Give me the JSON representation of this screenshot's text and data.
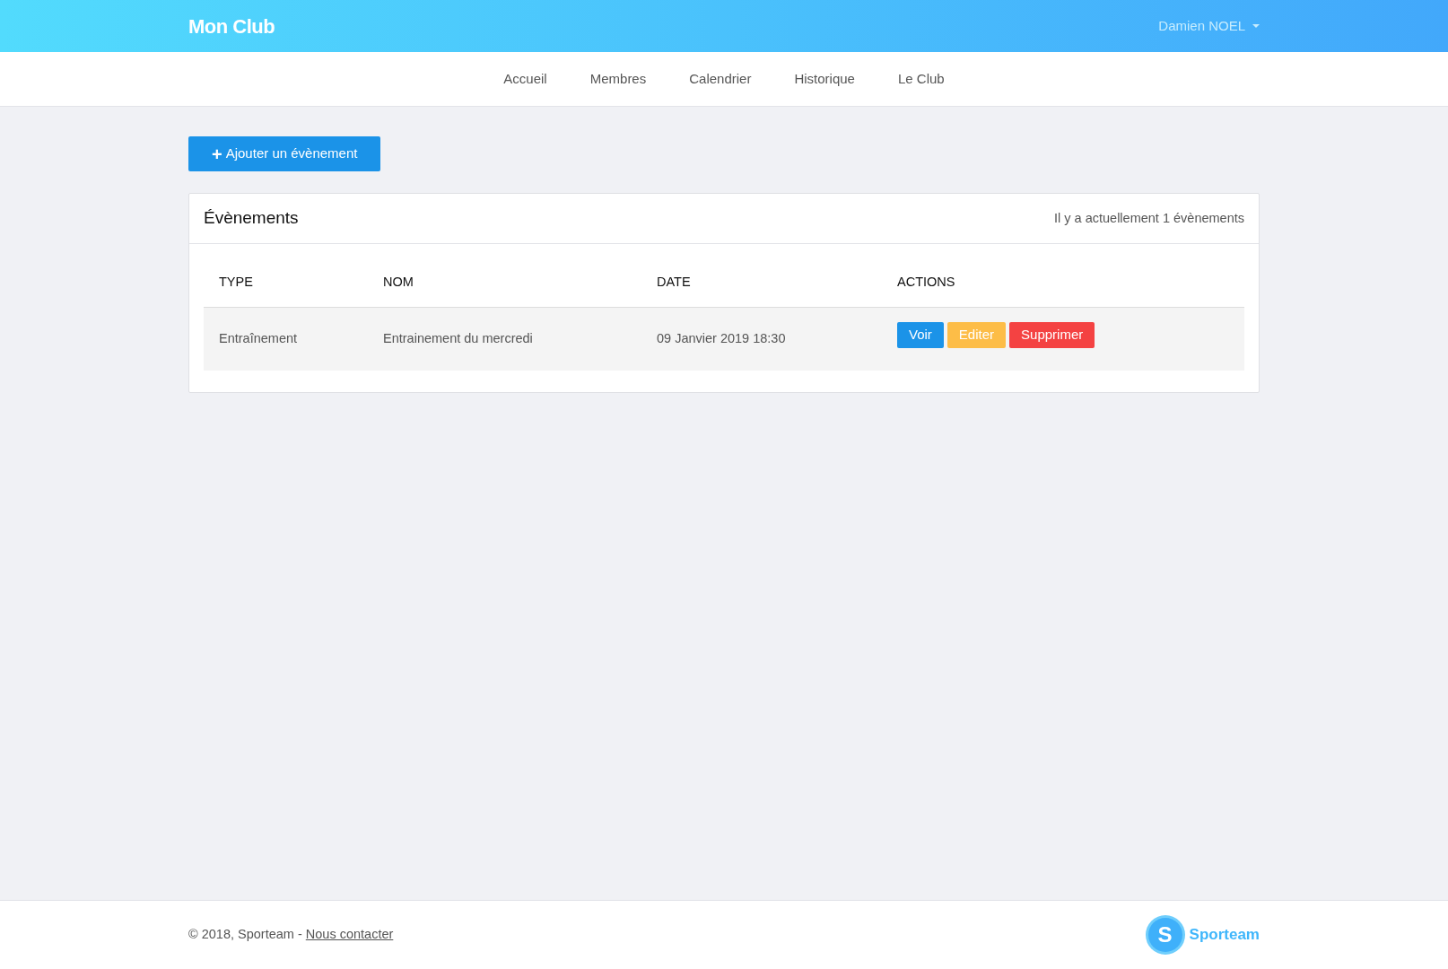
{
  "header": {
    "brand": "Mon Club",
    "user": "Damien NOEL"
  },
  "nav": [
    {
      "label": "Accueil"
    },
    {
      "label": "Membres"
    },
    {
      "label": "Calendrier"
    },
    {
      "label": "Historique"
    },
    {
      "label": "Le Club"
    }
  ],
  "add_button": {
    "icon": "+",
    "label": "Ajouter un évènement"
  },
  "card": {
    "title": "Évènements",
    "count_text": "Il y a actuellement 1 évènements",
    "table": {
      "columns": [
        "TYPE",
        "NOM",
        "DATE",
        "ACTIONS"
      ],
      "rows": [
        {
          "cells": [
            "Entraînement",
            "Entrainement du mercredi",
            "09 Janvier 2019 18:30"
          ],
          "actions": [
            {
              "label": "Voir",
              "kind": "view"
            },
            {
              "label": "Editer",
              "kind": "edit"
            },
            {
              "label": "Supprimer",
              "kind": "delete"
            }
          ]
        }
      ]
    }
  },
  "footer": {
    "copyright": "© 2018, Sporteam -",
    "link": "Nous contacter",
    "logo_letter": "S",
    "logo_text": "Sporteam"
  }
}
